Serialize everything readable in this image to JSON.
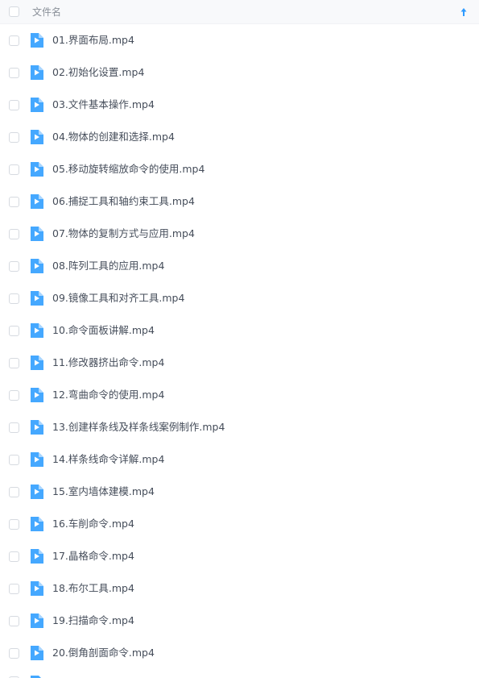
{
  "header": {
    "column_title": "文件名",
    "sort_icon": "arrow-up-icon",
    "accent_color": "#2f9bff"
  },
  "file_icon": "video-file-icon",
  "files": [
    {
      "name": "01.界面布局.mp4"
    },
    {
      "name": "02.初始化设置.mp4"
    },
    {
      "name": "03.文件基本操作.mp4"
    },
    {
      "name": "04.物体的创建和选择.mp4"
    },
    {
      "name": "05.移动旋转缩放命令的使用.mp4"
    },
    {
      "name": "06.捕捉工具和轴约束工具.mp4"
    },
    {
      "name": "07.物体的复制方式与应用.mp4"
    },
    {
      "name": "08.阵列工具的应用.mp4"
    },
    {
      "name": "09.镜像工具和对齐工具.mp4"
    },
    {
      "name": "10.命令面板讲解.mp4"
    },
    {
      "name": "11.修改器挤出命令.mp4"
    },
    {
      "name": "12.弯曲命令的使用.mp4"
    },
    {
      "name": "13.创建样条线及样条线案例制作.mp4"
    },
    {
      "name": "14.样条线命令详解.mp4"
    },
    {
      "name": "15.室内墙体建模.mp4"
    },
    {
      "name": "16.车削命令.mp4"
    },
    {
      "name": "17.晶格命令.mp4"
    },
    {
      "name": "18.布尔工具.mp4"
    },
    {
      "name": "19.扫描命令.mp4"
    },
    {
      "name": "20.倒角剖面命令.mp4"
    }
  ]
}
